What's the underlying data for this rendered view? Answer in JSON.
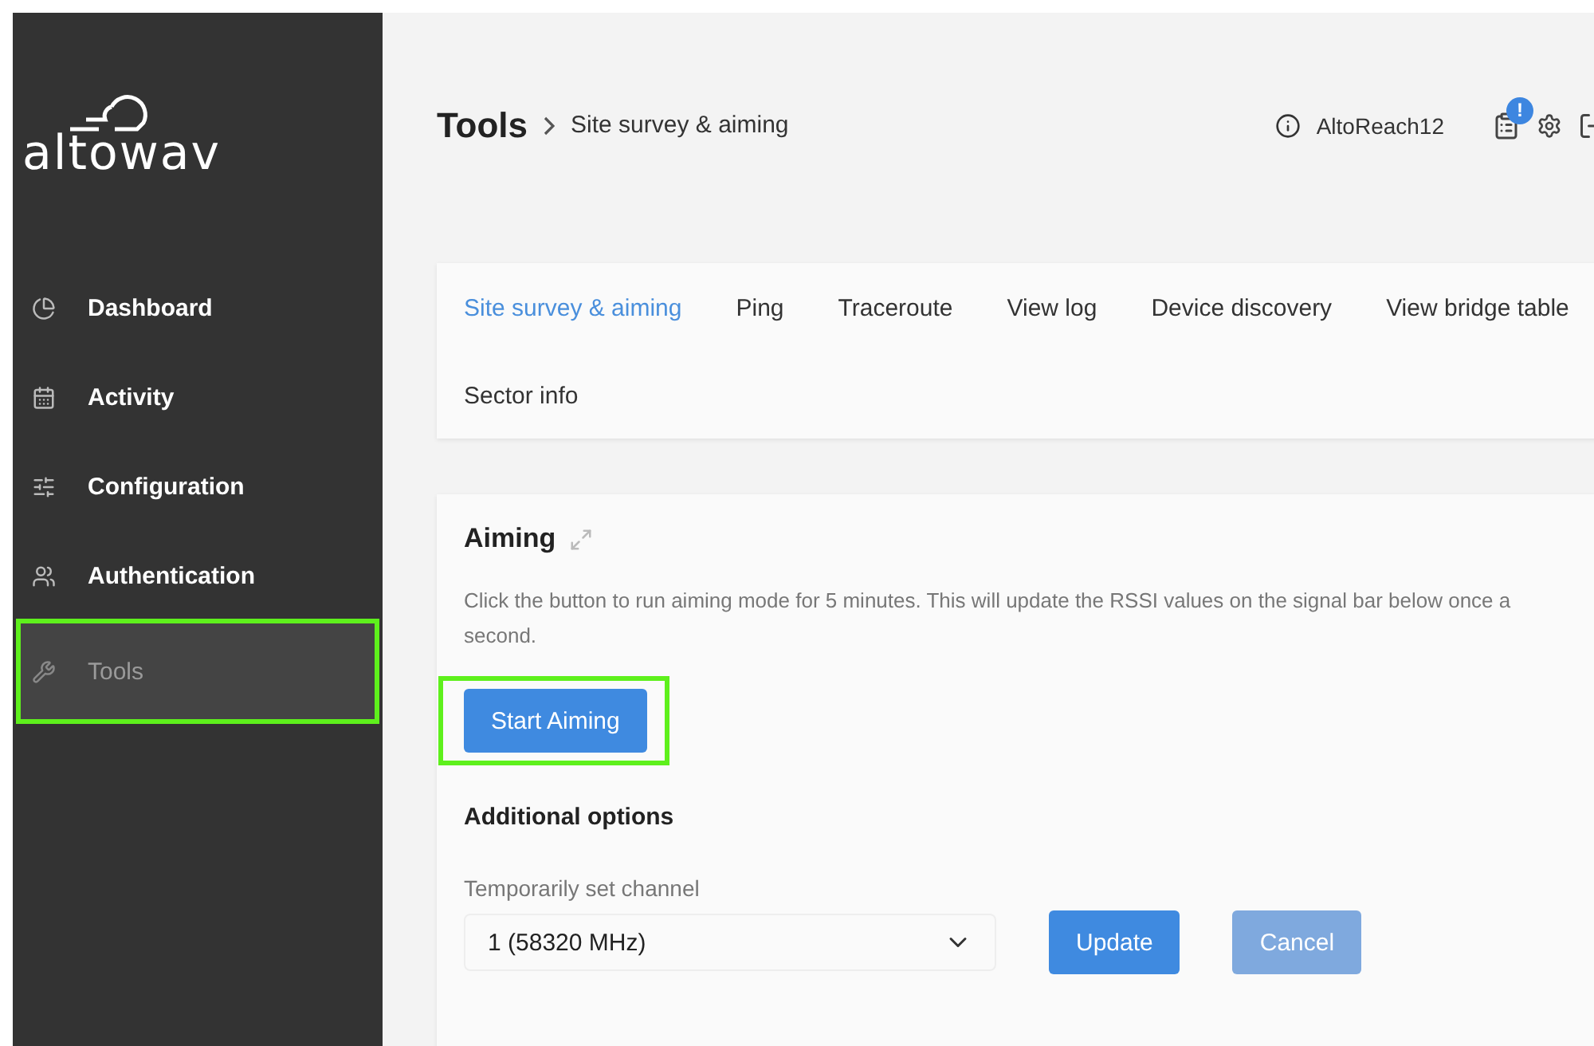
{
  "logo": "altowav",
  "sidebar": {
    "items": [
      {
        "label": "Dashboard",
        "selected": false,
        "highlighted": false
      },
      {
        "label": "Activity",
        "selected": false,
        "highlighted": false
      },
      {
        "label": "Configuration",
        "selected": false,
        "highlighted": false
      },
      {
        "label": "Authentication",
        "selected": false,
        "highlighted": false
      },
      {
        "label": "Tools",
        "selected": true,
        "highlighted": true
      }
    ]
  },
  "header": {
    "title": "Tools",
    "breadcrumb": "Site survey & aiming",
    "device": "AltoReach12",
    "notification_badge": "!"
  },
  "tabs": [
    {
      "label": "Site survey & aiming",
      "selected": true
    },
    {
      "label": "Ping",
      "selected": false
    },
    {
      "label": "Traceroute",
      "selected": false
    },
    {
      "label": "View log",
      "selected": false
    },
    {
      "label": "Device discovery",
      "selected": false
    },
    {
      "label": "View bridge table",
      "selected": false
    },
    {
      "label": "Sector info",
      "selected": false
    }
  ],
  "aiming": {
    "title": "Aiming",
    "description": "Click the button to run aiming mode for 5 minutes. This will update the RSSI values on the signal bar below once a second.",
    "start_button": {
      "label": "Start Aiming",
      "highlighted": true
    },
    "options_title": "Additional options",
    "channel_label": "Temporarily set channel",
    "channel_value": "1 (58320 MHz)",
    "buttons": [
      {
        "label": "Update",
        "disabled": false
      },
      {
        "label": "Cancel",
        "disabled": true
      }
    ]
  }
}
